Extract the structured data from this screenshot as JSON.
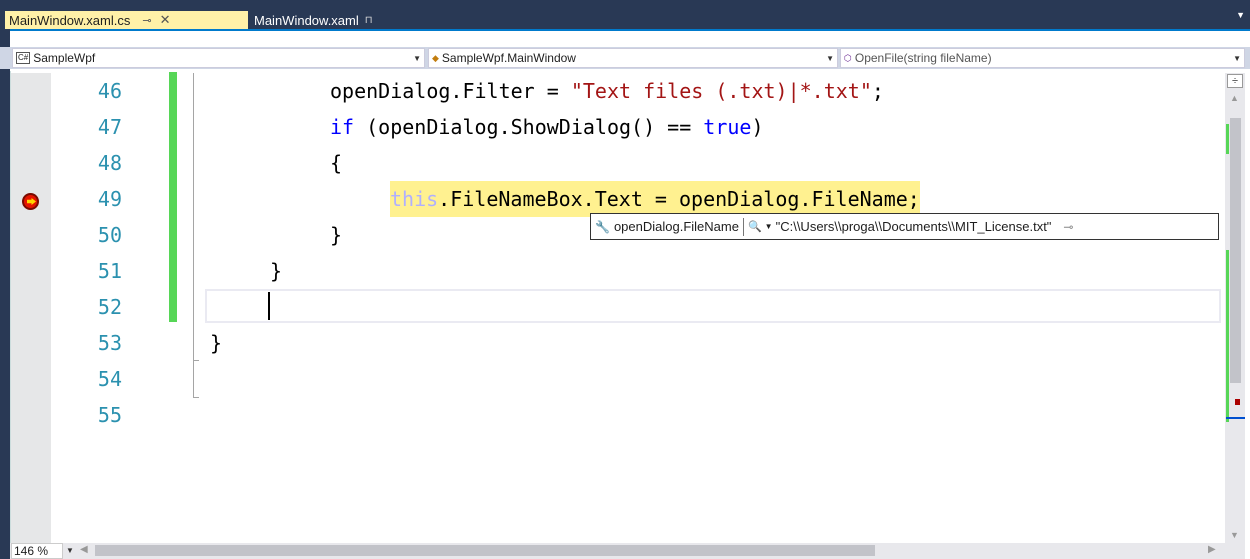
{
  "tabs": [
    {
      "label": "MainWindow.xaml.cs",
      "active": true
    },
    {
      "label": "MainWindow.xaml",
      "active": false
    }
  ],
  "navbar": {
    "project": "SampleWpf",
    "project_badge": "C#",
    "class": "SampleWpf.MainWindow",
    "member": "OpenFile(string fileName)"
  },
  "editor": {
    "line_numbers": [
      "46",
      "47",
      "48",
      "49",
      "50",
      "51",
      "52",
      "53",
      "54",
      "55"
    ],
    "code": {
      "l46_a": "openDialog.Filter = ",
      "l46_str": "\"Text files (.txt)|*.txt\"",
      "l46_b": ";",
      "l47_kw": "if",
      "l47_a": " (openDialog.ShowDialog() == ",
      "l47_kw2": "true",
      "l47_b": ")",
      "l48": "{",
      "l49_kw": "this",
      "l49_a": ".FileNameBox.Text = openDialog.FileName;",
      "l50": "}",
      "l51": "}",
      "l53": "}"
    },
    "breakpoint_line": "49"
  },
  "datatip": {
    "name": "openDialog.FileName",
    "value": "\"C:\\\\Users\\\\proga\\\\Documents\\\\MIT_License.txt\""
  },
  "status": {
    "zoom": "146 %"
  },
  "colors": {
    "tab_strip": "#293955",
    "active_tab": "#fff1a8",
    "keyword": "#0000ff",
    "string": "#a31515",
    "line_number": "#2b91af",
    "change_bar": "#57d657",
    "current_statement": "#fff190"
  }
}
